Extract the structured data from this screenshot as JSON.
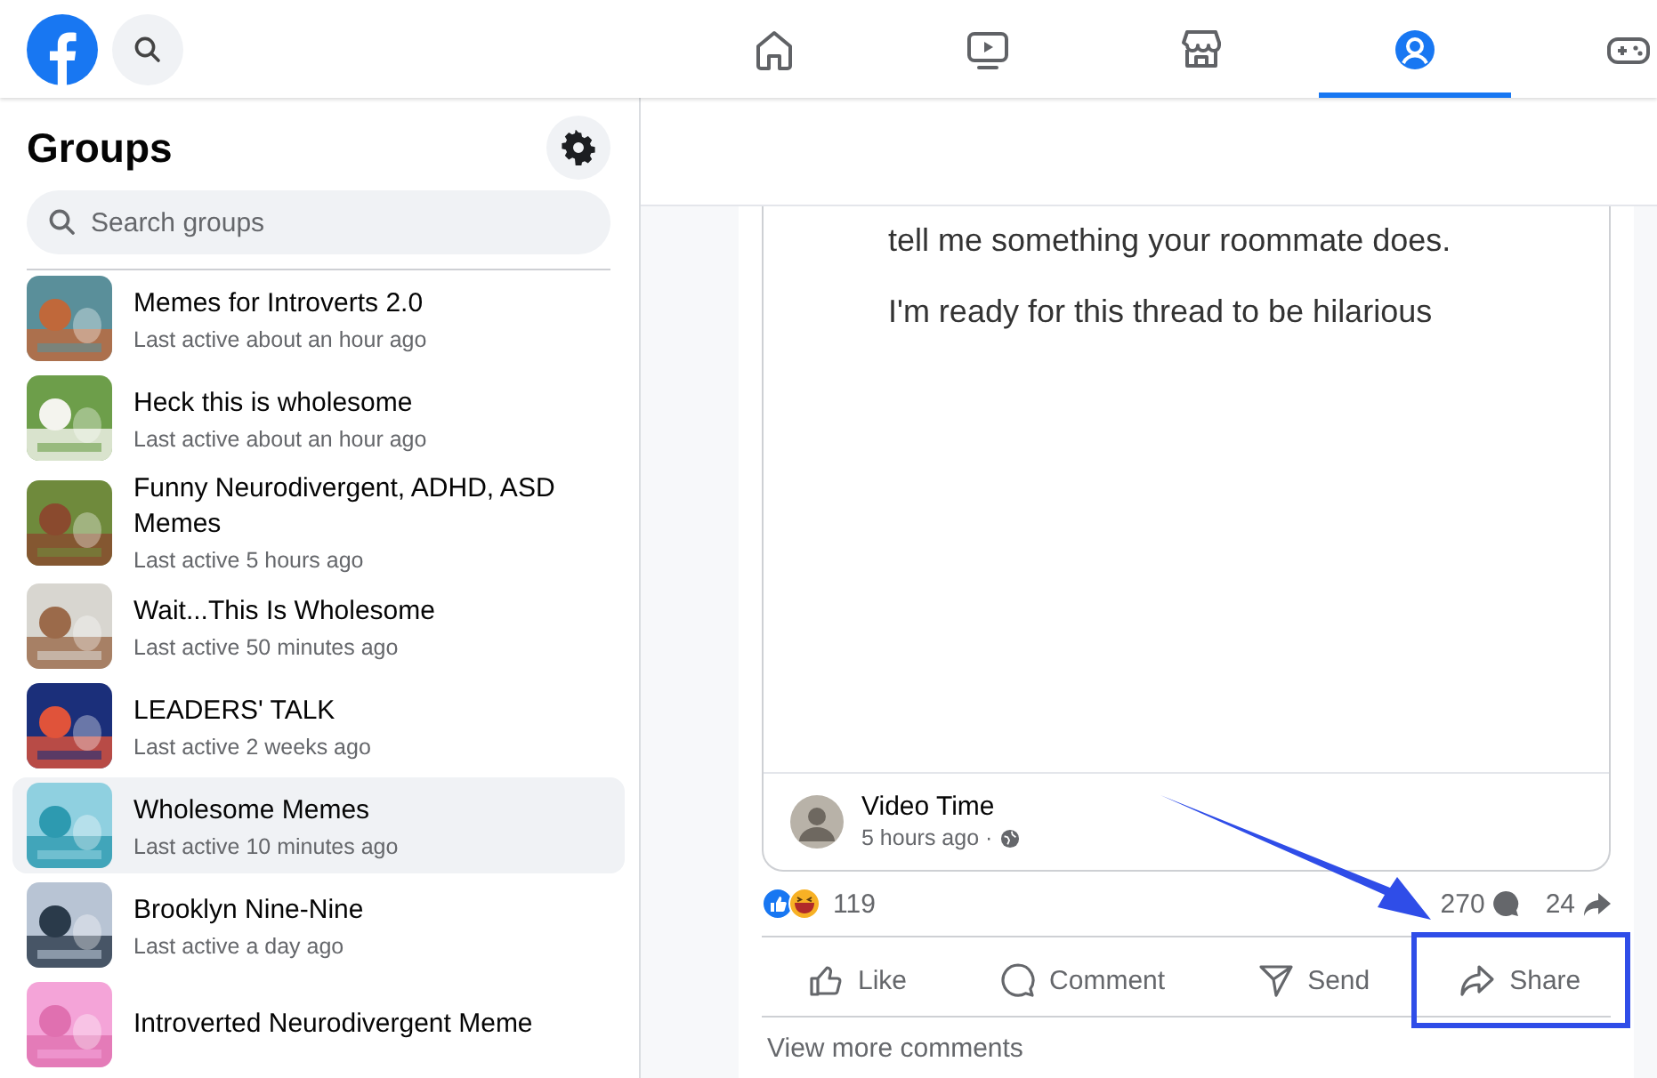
{
  "top_nav": {
    "tabs": [
      {
        "kind": "home",
        "selected": false
      },
      {
        "kind": "video",
        "selected": false
      },
      {
        "kind": "marketplace",
        "selected": false
      },
      {
        "kind": "groups",
        "selected": true
      },
      {
        "kind": "gaming",
        "selected": false
      }
    ]
  },
  "sidebar": {
    "title": "Groups",
    "search": {
      "placeholder": "Search groups"
    },
    "groups": [
      {
        "name": "Memes for Introverts 2.0",
        "last_active": "Last active about an hour ago",
        "selected": false
      },
      {
        "name": "Heck this is wholesome",
        "last_active": "Last active about an hour ago",
        "selected": false
      },
      {
        "name": "Funny Neurodivergent, ADHD, ASD Memes",
        "last_active": "Last active 5 hours ago",
        "selected": false
      },
      {
        "name": "Wait...This Is Wholesome",
        "last_active": "Last active 50 minutes ago",
        "selected": false
      },
      {
        "name": "LEADERS' TALK",
        "last_active": "Last active 2 weeks ago",
        "selected": false
      },
      {
        "name": "Wholesome Memes",
        "last_active": "Last active 10 minutes ago",
        "selected": true
      },
      {
        "name": "Brooklyn Nine-Nine",
        "last_active": "Last active a day ago",
        "selected": false
      },
      {
        "name": "Introverted Neurodivergent Meme",
        "selected": false
      }
    ]
  },
  "post": {
    "image_text": [
      "tell me something your roommate does.",
      "I'm ready for this thread to be hilarious"
    ],
    "author": "Video Time",
    "time": "5 hours ago ·",
    "reactions_count": "119",
    "comments_count": "270",
    "shares_count": "24",
    "actions": [
      {
        "kind": "like",
        "label": "Like",
        "highlighted": false
      },
      {
        "kind": "comment",
        "label": "Comment",
        "highlighted": false
      },
      {
        "kind": "send",
        "label": "Send",
        "highlighted": false
      },
      {
        "kind": "share",
        "label": "Share",
        "highlighted": true
      }
    ],
    "view_more": "View more comments"
  }
}
